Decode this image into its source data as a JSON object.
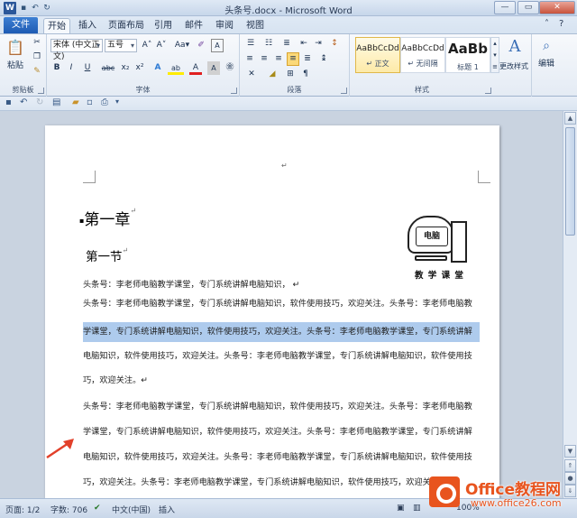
{
  "window": {
    "title": "头条号.docx - Microsoft Word",
    "app_icon": "W",
    "min": "—",
    "max": "▭",
    "close": "✕"
  },
  "tabs": {
    "file": "文件",
    "items": [
      "开始",
      "插入",
      "页面布局",
      "引用",
      "邮件",
      "审阅",
      "视图"
    ],
    "active": "开始"
  },
  "ribbon": {
    "clipboard": {
      "paste": "粘贴",
      "label": "剪贴板"
    },
    "font": {
      "font_name": "宋体 (中文正文)",
      "font_size": "五号",
      "grow": "A˄",
      "shrink": "A˅",
      "change_case": "Aa▾",
      "bold": "B",
      "italic": "I",
      "underline": "U",
      "strike": "abc",
      "sub": "x₂",
      "sup": "x²",
      "effects": "A",
      "highlight": "ab",
      "color": "A",
      "label": "字体"
    },
    "paragraph": {
      "label": "段落"
    },
    "styles": {
      "label": "样式",
      "items": [
        {
          "preview": "AaBbCcDd",
          "name": "↵ 正文"
        },
        {
          "preview": "AaBbCcDd",
          "name": "↵ 无间隔"
        },
        {
          "preview": "AaBb",
          "name": "标题 1"
        }
      ],
      "change_styles": "更改样式"
    },
    "editing": {
      "label": "编辑"
    }
  },
  "document": {
    "heading1": "第一章",
    "heading2": "第一节",
    "logo_screen": "电脑",
    "logo_caption": "教 学 课 堂",
    "para_mark": "↵",
    "lines": [
      "头条号：李老师电脑教学课堂，专门系统讲解电脑知识，  ↵",
      "头条号：李老师电脑教学课堂，专门系统讲解电脑知识，软件使用技巧，欢迎关注。头条号：李老师电脑教",
      "学课堂，专门系统讲解电脑知识，软件使用技巧，欢迎关注。头条号：李老师电脑教学课堂，专门系统讲解",
      "电脑知识，软件使用技巧，欢迎关注。头条号：李老师电脑教学课堂，专门系统讲解电脑知识，软件使用技",
      "巧，欢迎关注。↵",
      "头条号：李老师电脑教学课堂，专门系统讲解电脑知识，软件使用技巧，欢迎关注。头条号：李老师电脑教",
      "学课堂，专门系统讲解电脑知识，软件使用技巧，欢迎关注。头条号：李老师电脑教学课堂，专门系统讲解",
      "电脑知识，软件使用技巧，欢迎关注。头条号：李老师电脑教学课堂，专门系统讲解电脑知识，软件使用技",
      "巧，欢迎关注。头条号：李老师电脑教学课堂，专门系统讲解电脑知识，软件使用技巧，欢迎关注"
    ]
  },
  "status": {
    "page": "页面: 1/2",
    "words": "字数: 706",
    "lang": "中文(中国)",
    "mode": "插入",
    "zoom": "100%"
  },
  "watermark": {
    "line1": "Office教程网",
    "line2": "www.office26.com"
  },
  "colors": {
    "selection": "#aecbed",
    "arrow": "#e2402a",
    "file_tab": "#1e5bb3",
    "watermark": "#e8541e"
  }
}
